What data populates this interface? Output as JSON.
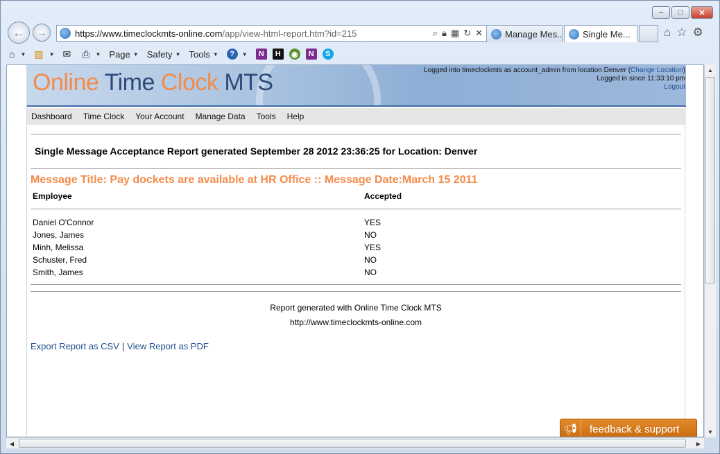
{
  "browser": {
    "url_host": "https://www.timeclockmts-online.com",
    "url_path": "/app/view-html-report.htm?id=215",
    "tabs": [
      {
        "label": "Manage Mes...",
        "active": false
      },
      {
        "label": "Single Me...",
        "active": true
      }
    ],
    "command_bar": {
      "page": "Page",
      "safety": "Safety",
      "tools": "Tools"
    }
  },
  "site": {
    "logo": {
      "part1": "Online",
      "part2": " Time ",
      "part3": "Clock",
      "part4": " MTS"
    },
    "login_line1_prefix": "Logged into timeclockmts as account_admin from location Denver (",
    "change_location": "Change Location",
    "login_line1_suffix": ")",
    "login_line2": "Logged in since 11:33:10 pm",
    "logout": "Logout",
    "menu": [
      "Dashboard",
      "Time Clock",
      "Your Account",
      "Manage Data",
      "Tools",
      "Help"
    ]
  },
  "report": {
    "title": "Single Message Acceptance Report generated September 28 2012 23:36:25 for Location: Denver",
    "message_title": "Message Title: Pay dockets are available at HR Office :: Message Date:March 15 2011",
    "columns": {
      "employee": "Employee",
      "accepted": "Accepted"
    },
    "rows": [
      {
        "employee": "Daniel O'Connor",
        "accepted": "YES"
      },
      {
        "employee": "Jones, James",
        "accepted": "NO"
      },
      {
        "employee": "Minh, Melissa",
        "accepted": "YES"
      },
      {
        "employee": "Schuster, Fred",
        "accepted": "NO"
      },
      {
        "employee": "Smith, James",
        "accepted": "NO"
      }
    ],
    "footer_line1": "Report generated with Online Time Clock MTS",
    "footer_line2": "http://www.timeclockmts-online.com",
    "export_csv": "Export Report as CSV",
    "export_sep": "|",
    "view_pdf": "View Report as PDF"
  },
  "feedback": {
    "label": "feedback & support"
  },
  "colors": {
    "accent_orange": "#f38b4a",
    "logo_blue": "#2e4a7a",
    "link_blue": "#1f4f8f",
    "feedback_orange": "#e28b2b"
  }
}
